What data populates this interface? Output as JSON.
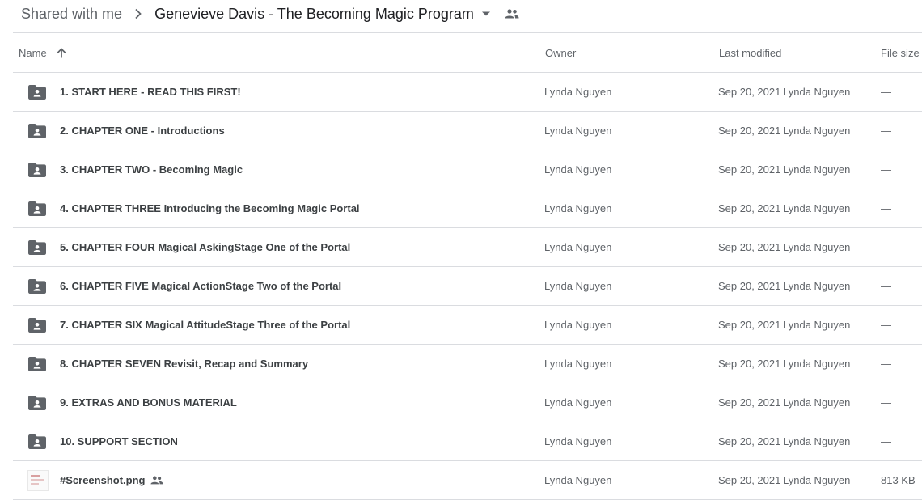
{
  "breadcrumb": {
    "root": "Shared with me",
    "separator_icon": "chevron-right-icon",
    "current": "Genevieve Davis - The Becoming Magic Program",
    "dropdown_icon": "caret-down-icon",
    "shared_icon": "people-icon"
  },
  "table": {
    "headers": {
      "name": "Name",
      "owner": "Owner",
      "last_modified": "Last modified",
      "file_size": "File size"
    },
    "sort": {
      "column": "name",
      "direction": "ascending",
      "icon": "arrow-up-icon"
    },
    "rows": [
      {
        "icon": "shared-folder-icon",
        "name": "1. START HERE - READ THIS FIRST!",
        "owner": "Lynda Nguyen",
        "date": "Sep 20, 2021",
        "modified_by": "Lynda Nguyen",
        "size": "—"
      },
      {
        "icon": "shared-folder-icon",
        "name": "2. CHAPTER ONE - Introductions",
        "owner": "Lynda Nguyen",
        "date": "Sep 20, 2021",
        "modified_by": "Lynda Nguyen",
        "size": "—"
      },
      {
        "icon": "shared-folder-icon",
        "name": "3. CHAPTER TWO - Becoming Magic",
        "owner": "Lynda Nguyen",
        "date": "Sep 20, 2021",
        "modified_by": "Lynda Nguyen",
        "size": "—"
      },
      {
        "icon": "shared-folder-icon",
        "name": "4. CHAPTER THREE Introducing the Becoming Magic Portal",
        "owner": "Lynda Nguyen",
        "date": "Sep 20, 2021",
        "modified_by": "Lynda Nguyen",
        "size": "—"
      },
      {
        "icon": "shared-folder-icon",
        "name": "5. CHAPTER FOUR Magical AskingStage One of the Portal",
        "owner": "Lynda Nguyen",
        "date": "Sep 20, 2021",
        "modified_by": "Lynda Nguyen",
        "size": "—"
      },
      {
        "icon": "shared-folder-icon",
        "name": "6. CHAPTER FIVE Magical ActionStage Two of the Portal",
        "owner": "Lynda Nguyen",
        "date": "Sep 20, 2021",
        "modified_by": "Lynda Nguyen",
        "size": "—"
      },
      {
        "icon": "shared-folder-icon",
        "name": "7. CHAPTER SIX Magical AttitudeStage Three of the Portal",
        "owner": "Lynda Nguyen",
        "date": "Sep 20, 2021",
        "modified_by": "Lynda Nguyen",
        "size": "—"
      },
      {
        "icon": "shared-folder-icon",
        "name": "8. CHAPTER SEVEN Revisit, Recap and Summary",
        "owner": "Lynda Nguyen",
        "date": "Sep 20, 2021",
        "modified_by": "Lynda Nguyen",
        "size": "—"
      },
      {
        "icon": "shared-folder-icon",
        "name": "9. EXTRAS AND BONUS MATERIAL",
        "owner": "Lynda Nguyen",
        "date": "Sep 20, 2021",
        "modified_by": "Lynda Nguyen",
        "size": "—"
      },
      {
        "icon": "shared-folder-icon",
        "name": "10. SUPPORT SECTION",
        "owner": "Lynda Nguyen",
        "date": "Sep 20, 2021",
        "modified_by": "Lynda Nguyen",
        "size": "—"
      },
      {
        "icon": "image-thumbnail-icon",
        "name": "#Screenshot.png",
        "shared": true,
        "owner": "Lynda Nguyen",
        "date": "Sep 20, 2021",
        "modified_by": "Lynda Nguyen",
        "size": "813 KB"
      }
    ]
  },
  "colors": {
    "text": "#3c4043",
    "muted": "#5f6368",
    "divider": "#dadce0",
    "folder_icon": "#5f6368"
  }
}
